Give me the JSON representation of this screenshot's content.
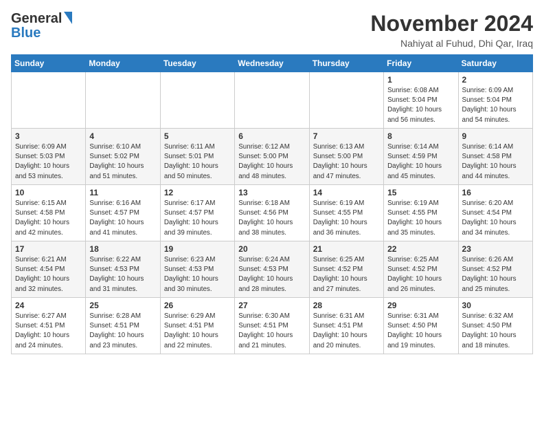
{
  "header": {
    "logo_general": "General",
    "logo_blue": "Blue",
    "month": "November 2024",
    "location": "Nahiyat al Fuhud, Dhi Qar, Iraq"
  },
  "days_of_week": [
    "Sunday",
    "Monday",
    "Tuesday",
    "Wednesday",
    "Thursday",
    "Friday",
    "Saturday"
  ],
  "weeks": [
    [
      {
        "day": "",
        "info": ""
      },
      {
        "day": "",
        "info": ""
      },
      {
        "day": "",
        "info": ""
      },
      {
        "day": "",
        "info": ""
      },
      {
        "day": "",
        "info": ""
      },
      {
        "day": "1",
        "info": "Sunrise: 6:08 AM\nSunset: 5:04 PM\nDaylight: 10 hours\nand 56 minutes."
      },
      {
        "day": "2",
        "info": "Sunrise: 6:09 AM\nSunset: 5:04 PM\nDaylight: 10 hours\nand 54 minutes."
      }
    ],
    [
      {
        "day": "3",
        "info": "Sunrise: 6:09 AM\nSunset: 5:03 PM\nDaylight: 10 hours\nand 53 minutes."
      },
      {
        "day": "4",
        "info": "Sunrise: 6:10 AM\nSunset: 5:02 PM\nDaylight: 10 hours\nand 51 minutes."
      },
      {
        "day": "5",
        "info": "Sunrise: 6:11 AM\nSunset: 5:01 PM\nDaylight: 10 hours\nand 50 minutes."
      },
      {
        "day": "6",
        "info": "Sunrise: 6:12 AM\nSunset: 5:00 PM\nDaylight: 10 hours\nand 48 minutes."
      },
      {
        "day": "7",
        "info": "Sunrise: 6:13 AM\nSunset: 5:00 PM\nDaylight: 10 hours\nand 47 minutes."
      },
      {
        "day": "8",
        "info": "Sunrise: 6:14 AM\nSunset: 4:59 PM\nDaylight: 10 hours\nand 45 minutes."
      },
      {
        "day": "9",
        "info": "Sunrise: 6:14 AM\nSunset: 4:58 PM\nDaylight: 10 hours\nand 44 minutes."
      }
    ],
    [
      {
        "day": "10",
        "info": "Sunrise: 6:15 AM\nSunset: 4:58 PM\nDaylight: 10 hours\nand 42 minutes."
      },
      {
        "day": "11",
        "info": "Sunrise: 6:16 AM\nSunset: 4:57 PM\nDaylight: 10 hours\nand 41 minutes."
      },
      {
        "day": "12",
        "info": "Sunrise: 6:17 AM\nSunset: 4:57 PM\nDaylight: 10 hours\nand 39 minutes."
      },
      {
        "day": "13",
        "info": "Sunrise: 6:18 AM\nSunset: 4:56 PM\nDaylight: 10 hours\nand 38 minutes."
      },
      {
        "day": "14",
        "info": "Sunrise: 6:19 AM\nSunset: 4:55 PM\nDaylight: 10 hours\nand 36 minutes."
      },
      {
        "day": "15",
        "info": "Sunrise: 6:19 AM\nSunset: 4:55 PM\nDaylight: 10 hours\nand 35 minutes."
      },
      {
        "day": "16",
        "info": "Sunrise: 6:20 AM\nSunset: 4:54 PM\nDaylight: 10 hours\nand 34 minutes."
      }
    ],
    [
      {
        "day": "17",
        "info": "Sunrise: 6:21 AM\nSunset: 4:54 PM\nDaylight: 10 hours\nand 32 minutes."
      },
      {
        "day": "18",
        "info": "Sunrise: 6:22 AM\nSunset: 4:53 PM\nDaylight: 10 hours\nand 31 minutes."
      },
      {
        "day": "19",
        "info": "Sunrise: 6:23 AM\nSunset: 4:53 PM\nDaylight: 10 hours\nand 30 minutes."
      },
      {
        "day": "20",
        "info": "Sunrise: 6:24 AM\nSunset: 4:53 PM\nDaylight: 10 hours\nand 28 minutes."
      },
      {
        "day": "21",
        "info": "Sunrise: 6:25 AM\nSunset: 4:52 PM\nDaylight: 10 hours\nand 27 minutes."
      },
      {
        "day": "22",
        "info": "Sunrise: 6:25 AM\nSunset: 4:52 PM\nDaylight: 10 hours\nand 26 minutes."
      },
      {
        "day": "23",
        "info": "Sunrise: 6:26 AM\nSunset: 4:52 PM\nDaylight: 10 hours\nand 25 minutes."
      }
    ],
    [
      {
        "day": "24",
        "info": "Sunrise: 6:27 AM\nSunset: 4:51 PM\nDaylight: 10 hours\nand 24 minutes."
      },
      {
        "day": "25",
        "info": "Sunrise: 6:28 AM\nSunset: 4:51 PM\nDaylight: 10 hours\nand 23 minutes."
      },
      {
        "day": "26",
        "info": "Sunrise: 6:29 AM\nSunset: 4:51 PM\nDaylight: 10 hours\nand 22 minutes."
      },
      {
        "day": "27",
        "info": "Sunrise: 6:30 AM\nSunset: 4:51 PM\nDaylight: 10 hours\nand 21 minutes."
      },
      {
        "day": "28",
        "info": "Sunrise: 6:31 AM\nSunset: 4:51 PM\nDaylight: 10 hours\nand 20 minutes."
      },
      {
        "day": "29",
        "info": "Sunrise: 6:31 AM\nSunset: 4:50 PM\nDaylight: 10 hours\nand 19 minutes."
      },
      {
        "day": "30",
        "info": "Sunrise: 6:32 AM\nSunset: 4:50 PM\nDaylight: 10 hours\nand 18 minutes."
      }
    ]
  ]
}
